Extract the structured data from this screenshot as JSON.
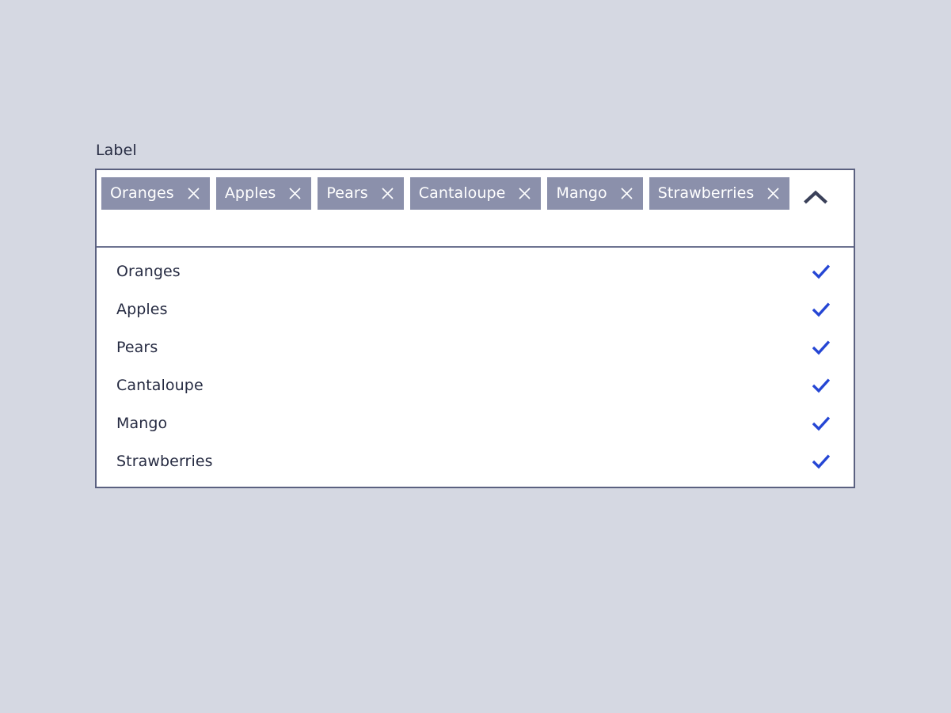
{
  "colors": {
    "page_background": "#d5d8e2",
    "chip_background": "#8b90ab",
    "chip_text": "#ffffff",
    "border": "#5b6180",
    "divider": "#6d7391",
    "text": "#262b42",
    "check_blue": "#2546d4",
    "surface": "#ffffff"
  },
  "field": {
    "label": "Label",
    "expanded": true,
    "toggle_icon": "chevron-up-icon"
  },
  "chips": [
    {
      "label": "Oranges",
      "remove_icon": "close-icon"
    },
    {
      "label": "Apples",
      "remove_icon": "close-icon"
    },
    {
      "label": "Pears",
      "remove_icon": "close-icon"
    },
    {
      "label": "Cantaloupe",
      "remove_icon": "close-icon"
    },
    {
      "label": "Mango",
      "remove_icon": "close-icon"
    },
    {
      "label": "Strawberries",
      "remove_icon": "close-icon"
    }
  ],
  "options": [
    {
      "label": "Oranges",
      "selected": true,
      "check_icon": "checkmark-icon"
    },
    {
      "label": "Apples",
      "selected": true,
      "check_icon": "checkmark-icon"
    },
    {
      "label": "Pears",
      "selected": true,
      "check_icon": "checkmark-icon"
    },
    {
      "label": "Cantaloupe",
      "selected": true,
      "check_icon": "checkmark-icon"
    },
    {
      "label": "Mango",
      "selected": true,
      "check_icon": "checkmark-icon"
    },
    {
      "label": "Strawberries",
      "selected": true,
      "check_icon": "checkmark-icon"
    }
  ]
}
